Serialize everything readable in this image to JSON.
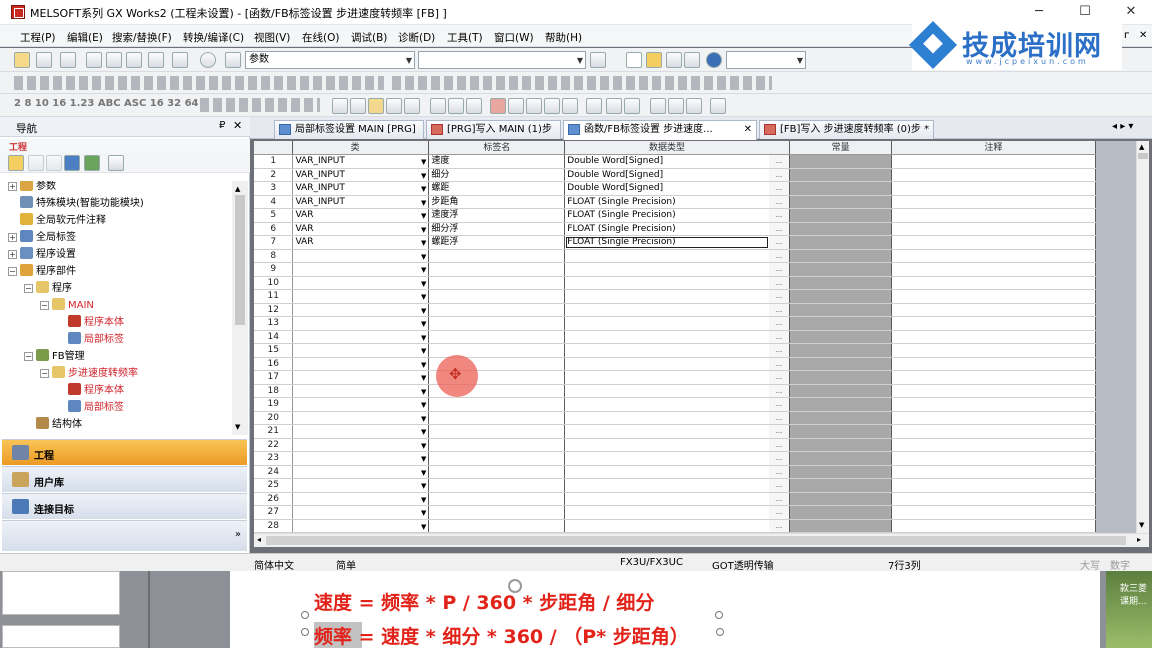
{
  "window": {
    "title": "MELSOFT系列 GX Works2 (工程未设置) - [函数/FB标签设置 步进速度转频率 [FB] ]",
    "minimize": "─",
    "maximize": "☐",
    "close": "✕",
    "mdi_restore": "ᴦ",
    "mdi_close": "✕"
  },
  "menu": [
    "工程(P)",
    "编辑(E)",
    "搜索/替换(F)",
    "转换/编译(C)",
    "视图(V)",
    "在线(O)",
    "调试(B)",
    "诊断(D)",
    "工具(T)",
    "窗口(W)",
    "帮助(H)"
  ],
  "toolbar": {
    "combo1_value": "参数",
    "combo2_value": "",
    "combo3_value": "",
    "row3_text": "2 8 10 16 1.23 ABC ASC 16 32 64"
  },
  "logo": {
    "name": "技成培训网",
    "url": "www.jcpeixun.com"
  },
  "nav": {
    "title": "导航",
    "pin": "₽",
    "close": "✕",
    "project_label": "工程",
    "tree": [
      {
        "label": "参数",
        "level": 0,
        "exp": "+",
        "red": false,
        "color": "#d9a441"
      },
      {
        "label": "特殊模块(智能功能模块)",
        "level": 0,
        "exp": "",
        "red": false,
        "color": "#6f8fb7"
      },
      {
        "label": "全局软元件注释",
        "level": 0,
        "exp": "",
        "red": false,
        "color": "#e2b33b"
      },
      {
        "label": "全局标签",
        "level": 0,
        "exp": "+",
        "red": false,
        "color": "#5e86bf"
      },
      {
        "label": "程序设置",
        "level": 0,
        "exp": "+",
        "red": false,
        "color": "#6a8fc0"
      },
      {
        "label": "程序部件",
        "level": 0,
        "exp": "−",
        "red": false,
        "color": "#e0a23a"
      },
      {
        "label": "程序",
        "level": 1,
        "exp": "−",
        "red": false,
        "color": "#e7c66a"
      },
      {
        "label": "MAIN",
        "level": 2,
        "exp": "−",
        "red": true,
        "color": "#e7c66a"
      },
      {
        "label": "程序本体",
        "level": 3,
        "exp": "",
        "red": true,
        "color": "#c0392b"
      },
      {
        "label": "局部标签",
        "level": 3,
        "exp": "",
        "red": true,
        "color": "#5e86bf"
      },
      {
        "label": "FB管理",
        "level": 1,
        "exp": "−",
        "red": false,
        "color": "#7c9b4a"
      },
      {
        "label": "步进速度转频率",
        "level": 2,
        "exp": "−",
        "red": true,
        "color": "#e7c66a"
      },
      {
        "label": "程序本体",
        "level": 3,
        "exp": "",
        "red": true,
        "color": "#c0392b"
      },
      {
        "label": "局部标签",
        "level": 3,
        "exp": "",
        "red": true,
        "color": "#5e86bf"
      },
      {
        "label": "结构体",
        "level": 1,
        "exp": "",
        "red": false,
        "color": "#b38a4a"
      }
    ],
    "bottom": [
      "工程",
      "用户库",
      "连接目标"
    ]
  },
  "tabs": [
    {
      "label": "局部标签设置 MAIN [PRG]",
      "active": false,
      "close": ""
    },
    {
      "label": "[PRG]写入 MAIN (1)步",
      "active": false,
      "close": ""
    },
    {
      "label": "函数/FB标签设置 步进速度...",
      "active": true,
      "close": "✕"
    },
    {
      "label": "[FB]写入 步进速度转频率 (0)步 *",
      "active": false,
      "close": ""
    }
  ],
  "tab_scroll": "◂ ▸ ▾",
  "grid": {
    "headers": [
      "",
      "类",
      "",
      "标签名",
      "数据类型",
      "",
      "常量",
      "注释"
    ],
    "rows": [
      {
        "n": "1",
        "cls": "VAR_INPUT",
        "name": "速度",
        "type": "Double Word[Signed]"
      },
      {
        "n": "2",
        "cls": "VAR_INPUT",
        "name": "细分",
        "type": "Double Word[Signed]"
      },
      {
        "n": "3",
        "cls": "VAR_INPUT",
        "name": "螺距",
        "type": "Double Word[Signed]"
      },
      {
        "n": "4",
        "cls": "VAR_INPUT",
        "name": "步距角",
        "type": "FLOAT (Single Precision)"
      },
      {
        "n": "5",
        "cls": "VAR",
        "name": "速度浮",
        "type": "FLOAT (Single Precision)"
      },
      {
        "n": "6",
        "cls": "VAR",
        "name": "细分浮",
        "type": "FLOAT (Single Precision)"
      },
      {
        "n": "7",
        "cls": "VAR",
        "name": "螺距浮",
        "type": "FLOAT (Single Precision)"
      },
      {
        "n": "8",
        "cls": "",
        "name": "",
        "type": ""
      },
      {
        "n": "9",
        "cls": "",
        "name": "",
        "type": ""
      },
      {
        "n": "10",
        "cls": "",
        "name": "",
        "type": ""
      },
      {
        "n": "11",
        "cls": "",
        "name": "",
        "type": ""
      },
      {
        "n": "12",
        "cls": "",
        "name": "",
        "type": ""
      },
      {
        "n": "13",
        "cls": "",
        "name": "",
        "type": ""
      },
      {
        "n": "14",
        "cls": "",
        "name": "",
        "type": ""
      },
      {
        "n": "15",
        "cls": "",
        "name": "",
        "type": ""
      },
      {
        "n": "16",
        "cls": "",
        "name": "",
        "type": ""
      },
      {
        "n": "17",
        "cls": "",
        "name": "",
        "type": ""
      },
      {
        "n": "18",
        "cls": "",
        "name": "",
        "type": ""
      },
      {
        "n": "19",
        "cls": "",
        "name": "",
        "type": ""
      },
      {
        "n": "20",
        "cls": "",
        "name": "",
        "type": ""
      },
      {
        "n": "21",
        "cls": "",
        "name": "",
        "type": ""
      },
      {
        "n": "22",
        "cls": "",
        "name": "",
        "type": ""
      },
      {
        "n": "23",
        "cls": "",
        "name": "",
        "type": ""
      },
      {
        "n": "24",
        "cls": "",
        "name": "",
        "type": ""
      },
      {
        "n": "25",
        "cls": "",
        "name": "",
        "type": ""
      },
      {
        "n": "26",
        "cls": "",
        "name": "",
        "type": ""
      },
      {
        "n": "27",
        "cls": "",
        "name": "",
        "type": ""
      },
      {
        "n": "28",
        "cls": "",
        "name": "",
        "type": ""
      }
    ],
    "dropdown_glyph": "▼",
    "dots_glyph": "...",
    "focused_row": 7
  },
  "status": {
    "lang": "简体中文",
    "mode": "简单",
    "plc": "FX3U/FX3UC",
    "conn": "GOT透明传输",
    "pos": "7行3列",
    "caps": "大写",
    "num": "数字"
  },
  "document": {
    "formula1": "速度 = 频率 * P / 360 * 步距角 / 细分",
    "formula2": "频率 = 速度 * 细分 * 360 / （P* 步距角）",
    "side_note": "款三菱\n课期..."
  },
  "colors": {
    "nav_active": "#f0a431",
    "formula_red": "#e2231a",
    "brand_blue": "#2b6fc6"
  }
}
